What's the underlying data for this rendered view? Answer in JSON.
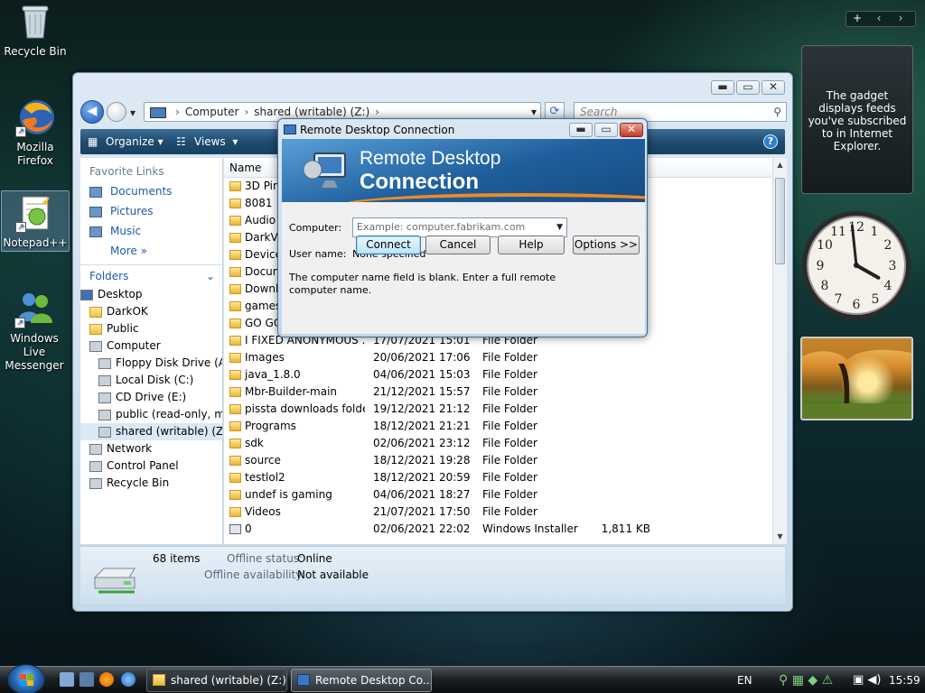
{
  "desktop": {
    "icons": [
      {
        "label": "Recycle Bin"
      },
      {
        "label": "Mozilla Firefox"
      },
      {
        "label": "Notepad++"
      },
      {
        "label": "Windows Live Messenger"
      }
    ]
  },
  "gadgets": {
    "feed_text": "The gadget displays feeds you've subscribed to in Internet Explorer.",
    "top_controls": [
      "+",
      "‹",
      "›"
    ],
    "clock": {
      "hour": 3,
      "minute": 59
    }
  },
  "explorer": {
    "address": {
      "crumbs": [
        "Computer",
        "shared (writable) (Z:)"
      ]
    },
    "search_placeholder": "Search",
    "toolbar": {
      "organize": "Organize",
      "views": "Views"
    },
    "favorites_header": "Favorite Links",
    "favorites": [
      "Documents",
      "Pictures",
      "Music",
      "More"
    ],
    "folders_header": "Folders",
    "tree": [
      {
        "label": "Desktop",
        "indent": 0
      },
      {
        "label": "DarkOK",
        "indent": 1
      },
      {
        "label": "Public",
        "indent": 1
      },
      {
        "label": "Computer",
        "indent": 1
      },
      {
        "label": "Floppy Disk Drive (A:)",
        "indent": 2
      },
      {
        "label": "Local Disk (C:)",
        "indent": 2
      },
      {
        "label": "CD Drive (E:)",
        "indent": 2
      },
      {
        "label": "public (read-only, mu",
        "indent": 2
      },
      {
        "label": "shared (writable) (Z:)",
        "indent": 2
      },
      {
        "label": "Network",
        "indent": 1
      },
      {
        "label": "Control Panel",
        "indent": 1
      },
      {
        "label": "Recycle Bin",
        "indent": 1
      }
    ],
    "columns": {
      "name": "Name"
    },
    "files": [
      {
        "name": "3D Pin",
        "date": "",
        "type": "",
        "size": ""
      },
      {
        "name": "8081",
        "date": "",
        "type": "",
        "size": ""
      },
      {
        "name": "Audio",
        "date": "",
        "type": "",
        "size": ""
      },
      {
        "name": "DarkVI",
        "date": "",
        "type": "",
        "size": ""
      },
      {
        "name": "Device",
        "date": "",
        "type": "",
        "size": ""
      },
      {
        "name": "Docun",
        "date": "",
        "type": "",
        "size": ""
      },
      {
        "name": "Downl",
        "date": "",
        "type": "",
        "size": ""
      },
      {
        "name": "games",
        "date": "",
        "type": "",
        "size": ""
      },
      {
        "name": "GO GO",
        "date": "",
        "type": "",
        "size": ""
      },
      {
        "name": "I FIXED ANONYMOUS ...",
        "date": "17/07/2021 15:01",
        "type": "File Folder",
        "size": ""
      },
      {
        "name": "Images",
        "date": "20/06/2021 17:06",
        "type": "File Folder",
        "size": ""
      },
      {
        "name": "java_1.8.0",
        "date": "04/06/2021 15:03",
        "type": "File Folder",
        "size": ""
      },
      {
        "name": "Mbr-Builder-main",
        "date": "21/12/2021 15:57",
        "type": "File Folder",
        "size": ""
      },
      {
        "name": "pissta downloads folder",
        "date": "19/12/2021 21:12",
        "type": "File Folder",
        "size": ""
      },
      {
        "name": "Programs",
        "date": "18/12/2021 21:21",
        "type": "File Folder",
        "size": ""
      },
      {
        "name": "sdk",
        "date": "02/06/2021 23:12",
        "type": "File Folder",
        "size": ""
      },
      {
        "name": "source",
        "date": "18/12/2021 19:28",
        "type": "File Folder",
        "size": ""
      },
      {
        "name": "testlol2",
        "date": "18/12/2021 20:59",
        "type": "File Folder",
        "size": ""
      },
      {
        "name": "undef is gaming",
        "date": "04/06/2021 18:27",
        "type": "File Folder",
        "size": ""
      },
      {
        "name": "Videos",
        "date": "21/07/2021 17:50",
        "type": "File Folder",
        "size": ""
      },
      {
        "name": "0",
        "date": "02/06/2021 22:02",
        "type": "Windows Installer ...",
        "size": "1,811 KB"
      }
    ],
    "details": {
      "items": "68 items",
      "offline_status_label": "Offline status:",
      "offline_status_value": "Online",
      "offline_avail_label": "Offline availability:",
      "offline_avail_value": "Not available"
    }
  },
  "rdc": {
    "window_title": "Remote Desktop Connection",
    "banner_line1": "Remote Desktop",
    "banner_line2": "Connection",
    "computer_label": "Computer:",
    "computer_placeholder": "Example: computer.fabrikam.com",
    "username_label": "User name:",
    "username_value": "None specified",
    "message": "The computer name field is blank. Enter a full remote computer name.",
    "buttons": {
      "connect": "Connect",
      "cancel": "Cancel",
      "help": "Help",
      "options": "Options >>"
    }
  },
  "taskbar": {
    "buttons": [
      {
        "label": "shared (writable) (Z:)"
      },
      {
        "label": "Remote Desktop Co..."
      }
    ],
    "language": "EN",
    "time": "15:59"
  }
}
